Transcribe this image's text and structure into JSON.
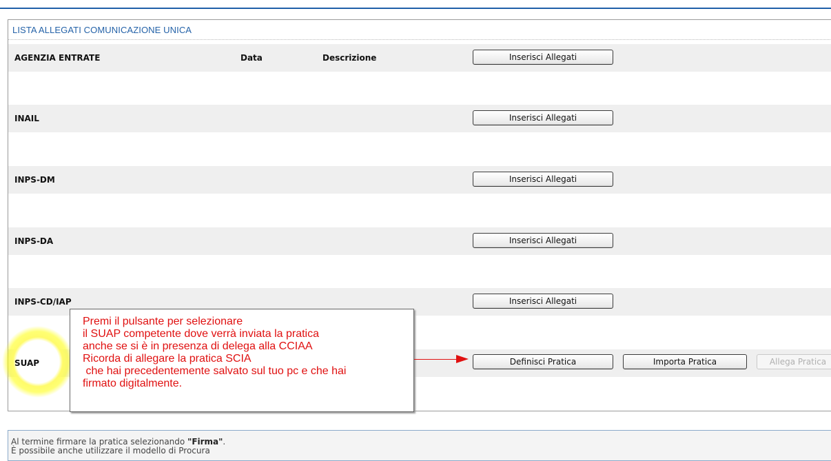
{
  "panel": {
    "title": "LISTA ALLEGATI COMUNICAZIONE UNICA"
  },
  "columns": {
    "date": "Data",
    "description": "Descrizione"
  },
  "rows": [
    {
      "label": "AGENZIA ENTRATE",
      "button": "Inserisci Allegati"
    },
    {
      "label": "INAIL",
      "button": "Inserisci Allegati"
    },
    {
      "label": "INPS-DM",
      "button": "Inserisci Allegati"
    },
    {
      "label": "INPS-DA",
      "button": "Inserisci Allegati"
    },
    {
      "label": "INPS-CD/IAP",
      "button": "Inserisci Allegati"
    }
  ],
  "suap": {
    "label": "SUAP",
    "define_button": "Definisci Pratica",
    "import_button": "Importa Pratica",
    "attach_button": "Allega Pratica"
  },
  "callout": {
    "lines": [
      "Premi il pulsante per selezionare",
      "il SUAP competente dove verrà inviata la pratica",
      "anche se si è in presenza di delega alla CCIAA",
      "Ricorda di allegare la pratica SCIA",
      " che hai precedentemente salvato sul tuo pc e che hai",
      "firmato digitalmente."
    ]
  },
  "footer": {
    "line1_prefix": "Al termine firmare la pratica selezionando ",
    "line1_emphasis": "\"Firma\"",
    "line1_suffix": ".",
    "line2": "È possibile anche utilizzare il modello di Procura"
  },
  "colors": {
    "title_blue": "#2462a8",
    "callout_red": "#e01010",
    "highlight": "#fffb6a"
  }
}
